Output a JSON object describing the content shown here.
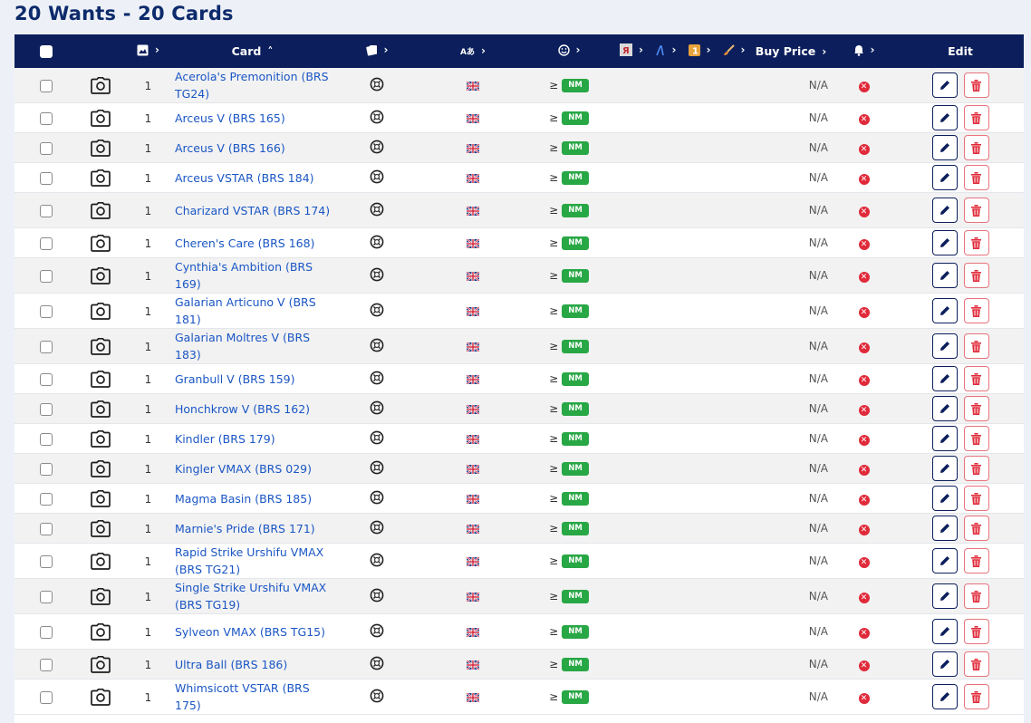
{
  "page": {
    "title": "20 Wants - 20 Cards"
  },
  "table": {
    "headers": {
      "card": "Card",
      "buy_price": "Buy Price",
      "edit": "Edit"
    },
    "rows": [
      {
        "qty": "1",
        "card": "Acerola's Premonition (BRS TG24)",
        "cond_sign": "≥",
        "cond": "NM",
        "price": "N/A"
      },
      {
        "qty": "1",
        "card": "Arceus V (BRS 165)",
        "cond_sign": "≥",
        "cond": "NM",
        "price": "N/A"
      },
      {
        "qty": "1",
        "card": "Arceus V (BRS 166)",
        "cond_sign": "≥",
        "cond": "NM",
        "price": "N/A"
      },
      {
        "qty": "1",
        "card": "Arceus VSTAR (BRS 184)",
        "cond_sign": "≥",
        "cond": "NM",
        "price": "N/A"
      },
      {
        "qty": "1",
        "card": "Charizard VSTAR (BRS 174)",
        "cond_sign": "≥",
        "cond": "NM",
        "price": "N/A"
      },
      {
        "qty": "1",
        "card": "Cheren's Care (BRS 168)",
        "cond_sign": "≥",
        "cond": "NM",
        "price": "N/A"
      },
      {
        "qty": "1",
        "card": "Cynthia's Ambition (BRS 169)",
        "cond_sign": "≥",
        "cond": "NM",
        "price": "N/A"
      },
      {
        "qty": "1",
        "card": "Galarian Articuno V (BRS 181)",
        "cond_sign": "≥",
        "cond": "NM",
        "price": "N/A"
      },
      {
        "qty": "1",
        "card": "Galarian Moltres V (BRS 183)",
        "cond_sign": "≥",
        "cond": "NM",
        "price": "N/A"
      },
      {
        "qty": "1",
        "card": "Granbull V (BRS 159)",
        "cond_sign": "≥",
        "cond": "NM",
        "price": "N/A"
      },
      {
        "qty": "1",
        "card": "Honchkrow V (BRS 162)",
        "cond_sign": "≥",
        "cond": "NM",
        "price": "N/A"
      },
      {
        "qty": "1",
        "card": "Kindler (BRS 179)",
        "cond_sign": "≥",
        "cond": "NM",
        "price": "N/A"
      },
      {
        "qty": "1",
        "card": "Kingler VMAX (BRS 029)",
        "cond_sign": "≥",
        "cond": "NM",
        "price": "N/A"
      },
      {
        "qty": "1",
        "card": "Magma Basin (BRS 185)",
        "cond_sign": "≥",
        "cond": "NM",
        "price": "N/A"
      },
      {
        "qty": "1",
        "card": "Marnie's Pride (BRS 171)",
        "cond_sign": "≥",
        "cond": "NM",
        "price": "N/A"
      },
      {
        "qty": "1",
        "card": "Rapid Strike Urshifu VMAX (BRS TG21)",
        "cond_sign": "≥",
        "cond": "NM",
        "price": "N/A"
      },
      {
        "qty": "1",
        "card": "Single Strike Urshifu VMAX (BRS TG19)",
        "cond_sign": "≥",
        "cond": "NM",
        "price": "N/A"
      },
      {
        "qty": "1",
        "card": "Sylveon VMAX (BRS TG15)",
        "cond_sign": "≥",
        "cond": "NM",
        "price": "N/A"
      },
      {
        "qty": "1",
        "card": "Ultra Ball (BRS 186)",
        "cond_sign": "≥",
        "cond": "NM",
        "price": "N/A"
      },
      {
        "qty": "1",
        "card": "Whimsicott VSTAR (BRS 175)",
        "cond_sign": "≥",
        "cond": "NM",
        "price": "N/A"
      }
    ]
  },
  "icons": {
    "photo": "camera-icon",
    "edition": "edition-symbol-icon",
    "language": "uk-flag-icon",
    "alert": "x-circle-icon",
    "edit": "pencil-icon",
    "delete": "trash-icon"
  },
  "colors": {
    "header_bg": "#0c1f5c",
    "link": "#1a56c4",
    "nm_badge": "#28a745",
    "danger": "#e02a3a"
  }
}
